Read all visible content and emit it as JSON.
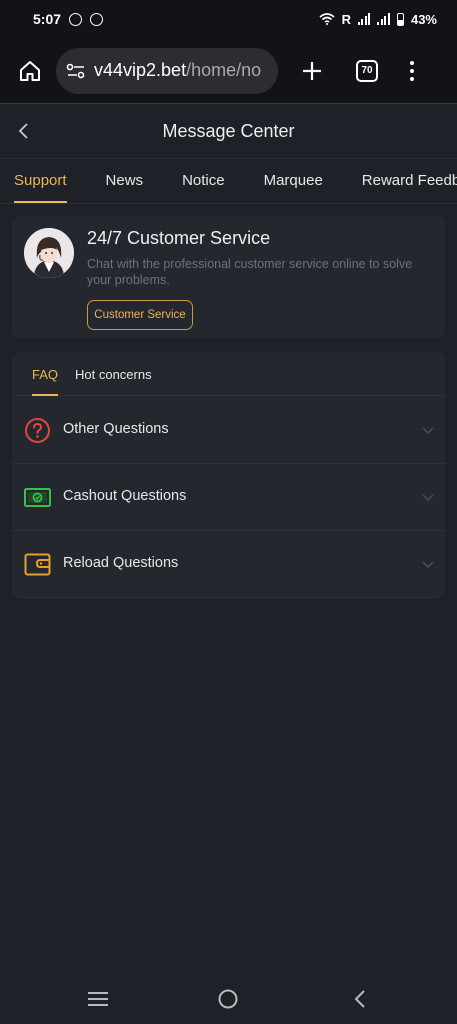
{
  "status_bar": {
    "time": "5:07",
    "roaming": "R",
    "battery": "43%"
  },
  "browser": {
    "url_domain": "v44vip2.bet",
    "url_path": "/home/no",
    "tab_count": "70"
  },
  "header": {
    "title": "Message Center"
  },
  "top_tabs": [
    {
      "label": "Support",
      "active": true
    },
    {
      "label": "News",
      "active": false
    },
    {
      "label": "Notice",
      "active": false
    },
    {
      "label": "Marquee",
      "active": false
    },
    {
      "label": "Reward Feedb",
      "active": false
    }
  ],
  "customer_service": {
    "title": "24/7 Customer Service",
    "description": "Chat with the professional customer service online to solve your problems.",
    "button_label": "Customer Service"
  },
  "faq": {
    "tabs": [
      {
        "label": "FAQ",
        "active": true
      },
      {
        "label": "Hot concerns",
        "active": false
      }
    ],
    "items": [
      {
        "label": "Other Questions",
        "icon": "question-icon",
        "color": "#e0463c"
      },
      {
        "label": "Cashout Questions",
        "icon": "cash-icon",
        "color": "#36c24a"
      },
      {
        "label": "Reload Questions",
        "icon": "wallet-icon",
        "color": "#e3a12c"
      }
    ]
  },
  "colors": {
    "accent": "#e8b756",
    "background": "#1f2128",
    "card": "#25272e"
  }
}
